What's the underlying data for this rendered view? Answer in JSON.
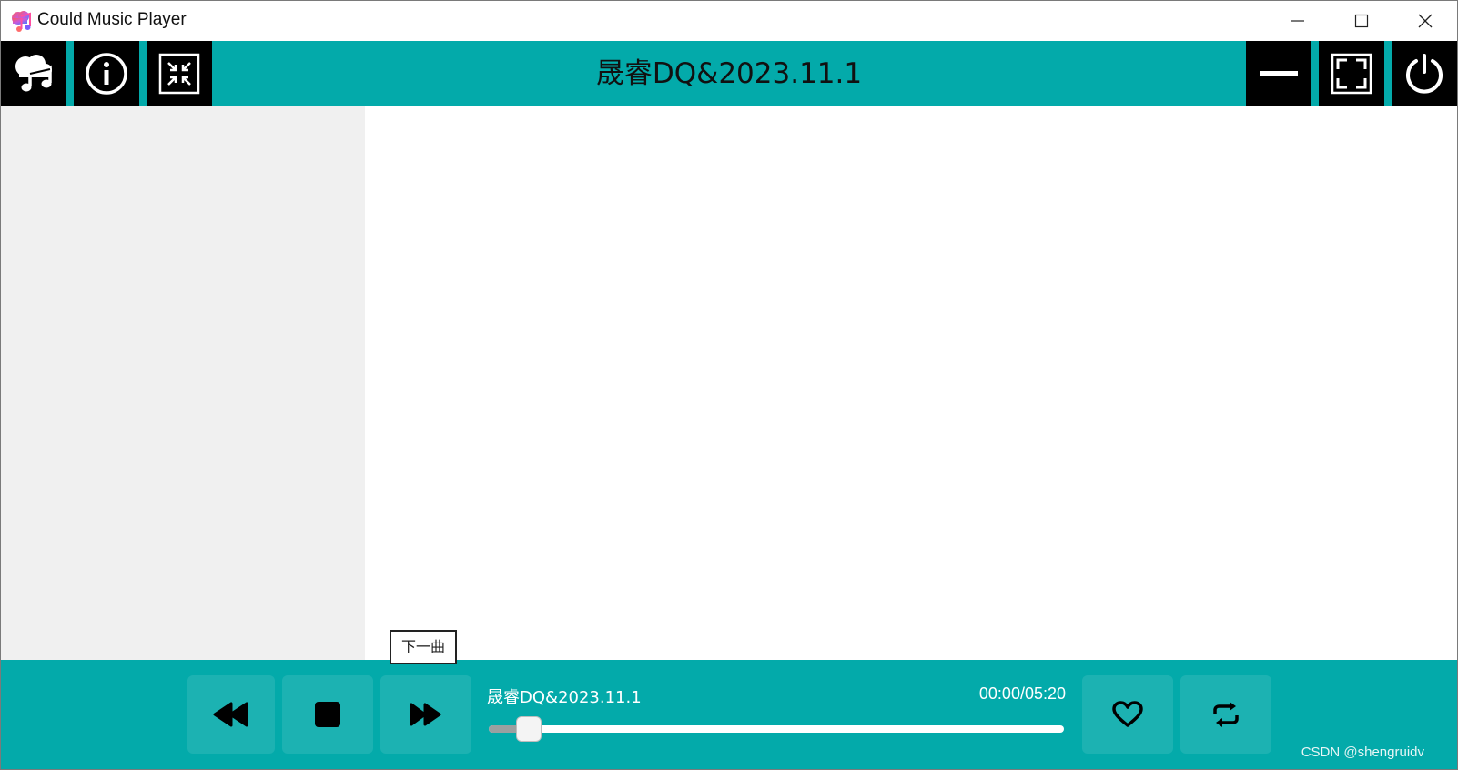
{
  "window": {
    "title": "Could Music Player",
    "icon": "music-cloud-app-icon"
  },
  "toolbar": {
    "left_buttons": [
      "music-cloud-icon",
      "info-icon",
      "compress-icon"
    ],
    "song_title": "晟睿DQ&2023.11.1",
    "right_buttons": [
      "minimize-bar-icon",
      "fullscreen-icon",
      "power-icon"
    ]
  },
  "tooltip": {
    "text": "下一曲"
  },
  "player": {
    "buttons": [
      "rewind-icon",
      "stop-icon",
      "fast-forward-icon"
    ],
    "now_playing": "晟睿DQ&2023.11.1",
    "time": "00:00/05:20",
    "progress_fraction": 0.07,
    "extra_buttons": [
      "heart-icon",
      "repeat-icon"
    ]
  },
  "watermark": "CSDN @shengruidv",
  "colors": {
    "accent": "#03aaaa",
    "toolbar_button": "#000000",
    "sidebar": "#f0f0f0"
  }
}
